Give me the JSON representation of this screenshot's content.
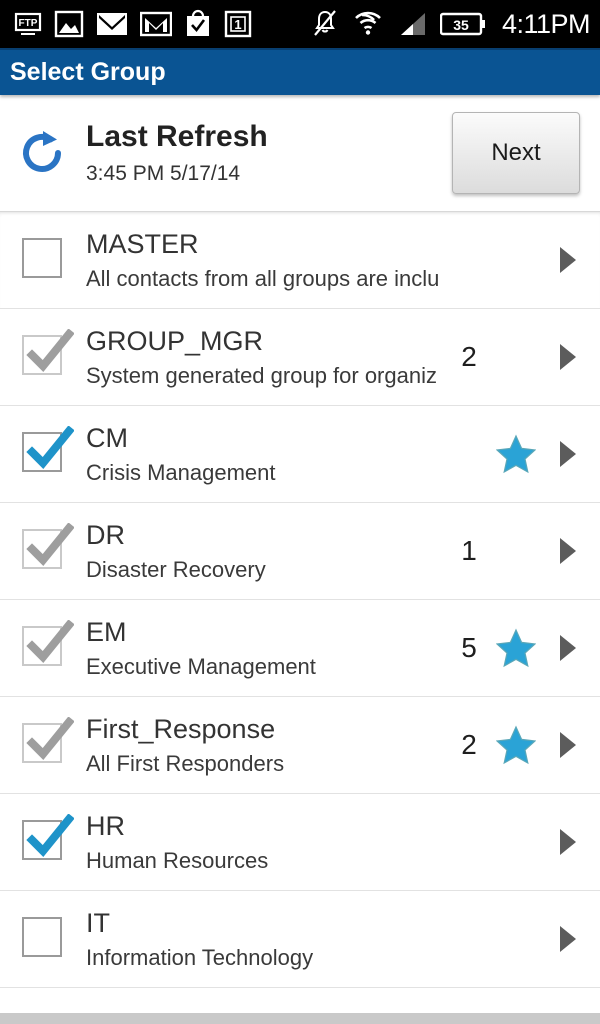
{
  "statusbar": {
    "icons_left": [
      "ftp-icon",
      "gallery-icon",
      "email-icon",
      "gmail-icon",
      "play-store-icon",
      "calendar-icon"
    ],
    "calendar_day": "1",
    "icons_right": [
      "silent-bell-icon",
      "wifi-icon",
      "cellular-signal-icon"
    ],
    "battery_level": "35",
    "time": "4:11PM"
  },
  "titlebar": {
    "title": "Select Group"
  },
  "refresh": {
    "icon": "refresh-icon",
    "title": "Last Refresh",
    "timestamp": "3:45 PM 5/17/14",
    "next_label": "Next"
  },
  "colors": {
    "title_bar": "#0a5493",
    "accent_blue": "#2aa3d6",
    "check_blue": "#1e93c9",
    "check_gray": "#9e9e9e",
    "status_bar": "#000000"
  },
  "groups": [
    {
      "name": "MASTER",
      "description": "All contacts from all groups are inclu…",
      "checkbox": "unchecked",
      "count": "",
      "starred": false
    },
    {
      "name": "GROUP_MGR",
      "description": "System generated group for organizi…",
      "checkbox": "checked-gray",
      "count": "2",
      "starred": false
    },
    {
      "name": "CM",
      "description": "Crisis Management",
      "checkbox": "checked-blue",
      "count": "",
      "starred": true
    },
    {
      "name": "DR",
      "description": "Disaster Recovery",
      "checkbox": "checked-gray",
      "count": "1",
      "starred": false
    },
    {
      "name": "EM",
      "description": "Executive Management",
      "checkbox": "checked-gray",
      "count": "5",
      "starred": true
    },
    {
      "name": "First_Response",
      "description": "All First Responders",
      "checkbox": "checked-gray",
      "count": "2",
      "starred": true
    },
    {
      "name": "HR",
      "description": "Human Resources",
      "checkbox": "checked-blue",
      "count": "",
      "starred": false
    },
    {
      "name": "IT",
      "description": "Information Technology",
      "checkbox": "unchecked",
      "count": "",
      "starred": false
    }
  ]
}
